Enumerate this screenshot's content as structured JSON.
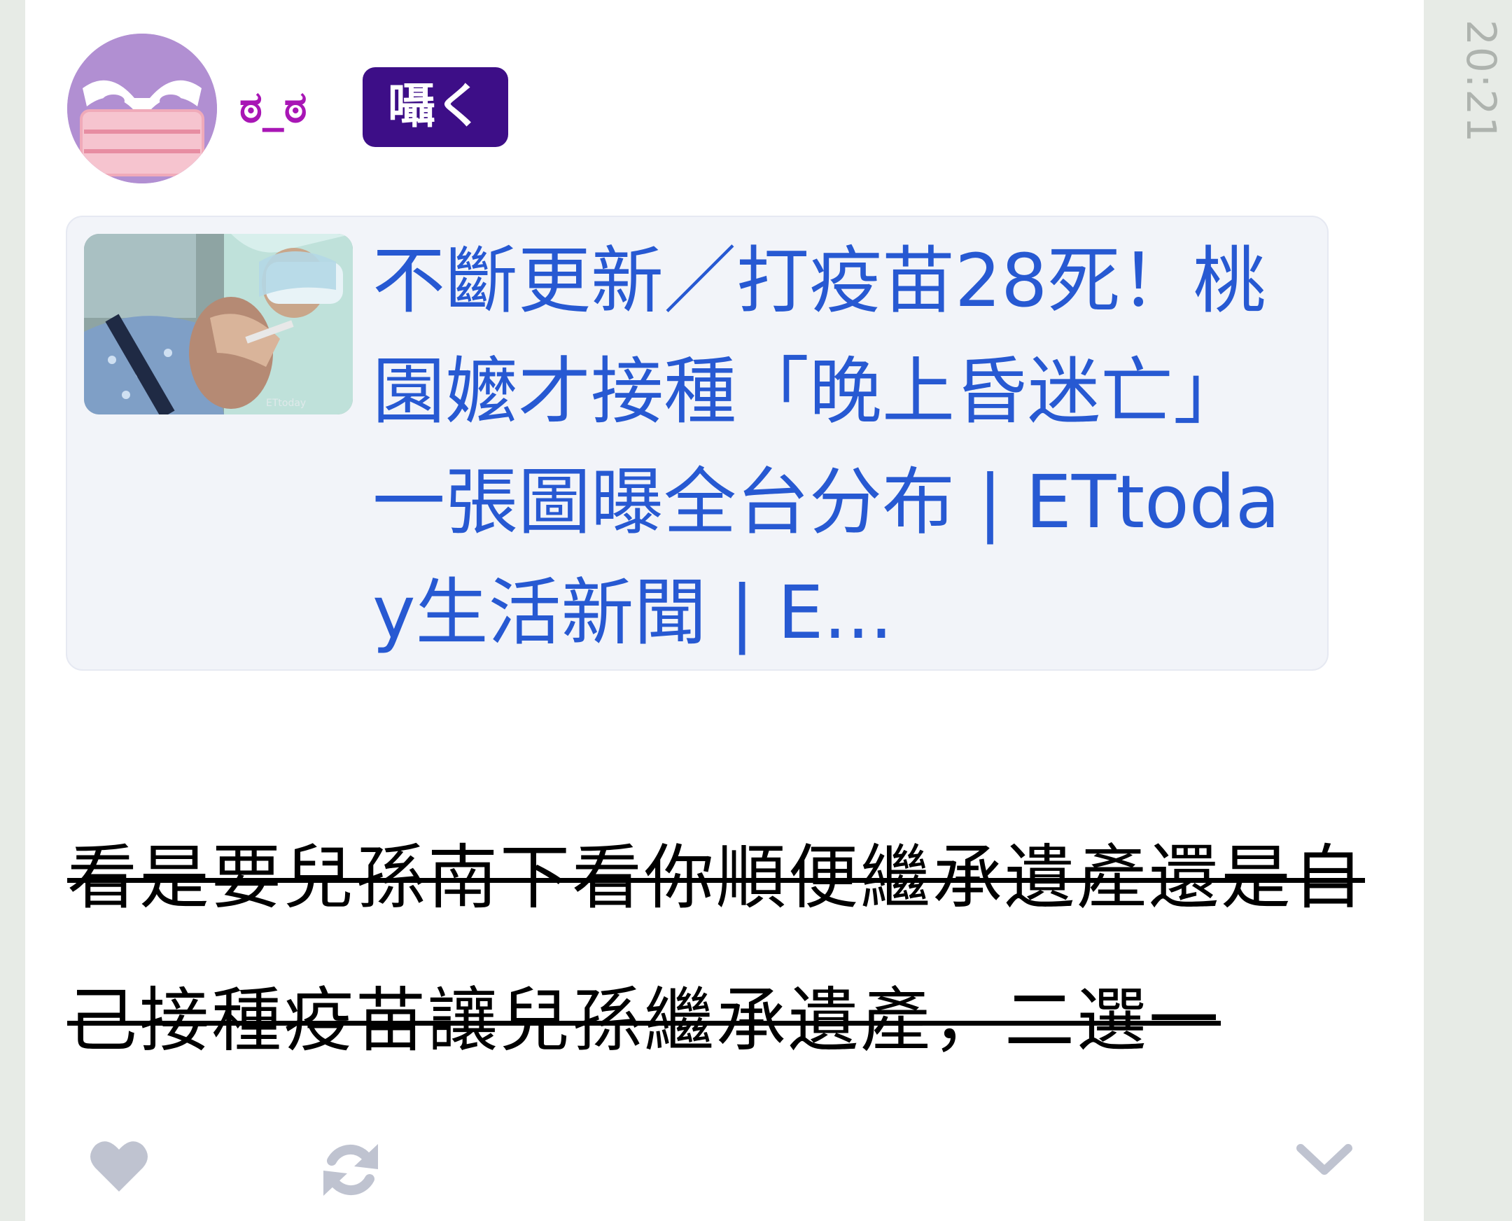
{
  "status": {
    "time": "20:21"
  },
  "post": {
    "author": {
      "display_name": "ಠ_ಠ",
      "flair": "囁く",
      "avatar_icon": "masked-owl-avatar"
    },
    "link_preview": {
      "title": "不斷更新／打疫苗28死！桃園嬤才接種「晚上昏迷亡」一張圖曝全台分布 | ETtoday生活新聞 | E...",
      "thumbnail_icon": "vaccination-photo"
    },
    "body_text": "看是要兒孫南下看你順便繼承遺產還是自己接種疫苗讓兒孫繼承遺產，二選一"
  },
  "actions": {
    "like_icon": "heart-icon",
    "repost_icon": "repost-icon",
    "more_icon": "chevron-down-icon"
  },
  "colors": {
    "background": "#e7ebe6",
    "card": "#ffffff",
    "name": "#a816b5",
    "flair_bg": "#3d0e87",
    "link": "#2759d2",
    "icon_gray": "#bfc3d0"
  }
}
